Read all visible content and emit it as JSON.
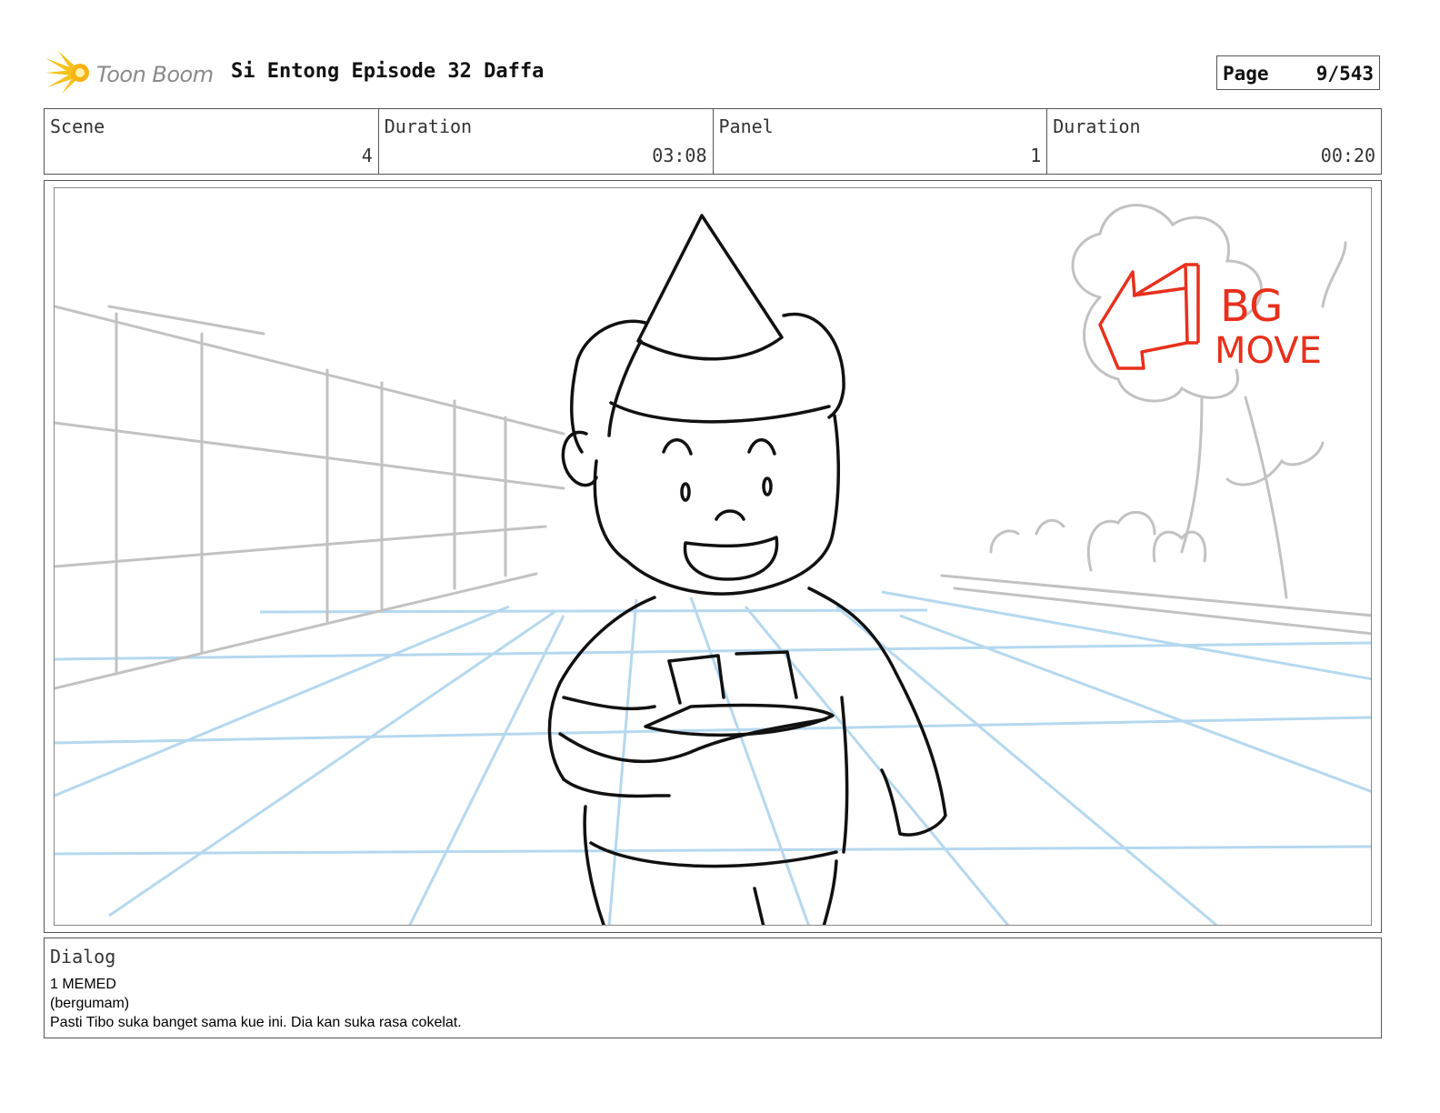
{
  "header": {
    "logo_text": "Toon Boom",
    "title": "Si Entong Episode 32 Daffa",
    "page_label": "Page",
    "page_value": "9/543"
  },
  "info": {
    "scene_label": "Scene",
    "scene_value": "4",
    "scene_duration_label": "Duration",
    "scene_duration_value": "03:08",
    "panel_label": "Panel",
    "panel_value": "1",
    "panel_duration_label": "Duration",
    "panel_duration_value": "00:20"
  },
  "sketch": {
    "note_line1": "BG",
    "note_line2": "MOVE",
    "note_color": "#e8301c",
    "guide_color": "#b5d8ef",
    "bg_line_color": "#c2c2c2",
    "ink_color": "#111111"
  },
  "dialog": {
    "label": "Dialog",
    "lines": [
      "1 MEMED",
      "(bergumam)",
      "Pasti Tibo suka banget sama kue ini. Dia kan suka rasa cokelat."
    ]
  }
}
